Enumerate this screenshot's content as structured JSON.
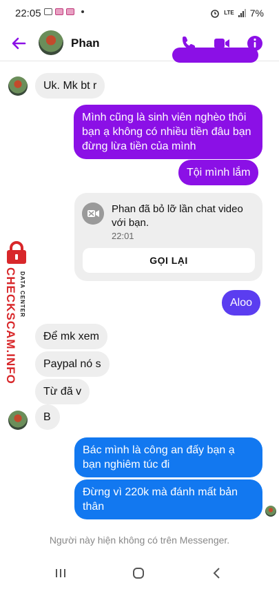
{
  "status_bar": {
    "time": "22:05",
    "network": "LTE",
    "battery": "7%"
  },
  "header": {
    "contact_name": "Phan"
  },
  "messages": [
    {
      "id": "m1",
      "side": "incoming",
      "text": "Uk. Mk bt r"
    },
    {
      "id": "m2",
      "side": "outgoing",
      "text": "Mình cũng là sinh viên nghèo thôi bạn ạ không có nhiều tiền đâu bạn đừng lừa tiền của mình"
    },
    {
      "id": "m3",
      "side": "outgoing",
      "text": "Tội mình lắm"
    },
    {
      "id": "m4",
      "side": "outgoing",
      "text": "Aloo"
    },
    {
      "id": "m5",
      "side": "incoming",
      "text": "Để mk xem"
    },
    {
      "id": "m6",
      "side": "incoming",
      "text": "Paypal nó s"
    },
    {
      "id": "m7",
      "side": "incoming",
      "text": "Từ đã v"
    },
    {
      "id": "m8",
      "side": "incoming",
      "text": "B"
    },
    {
      "id": "m9",
      "side": "outgoing",
      "text": "Bác mình là công an đấy bạn ạ bạn nghiêm túc đi"
    },
    {
      "id": "m10",
      "side": "outgoing",
      "text": "Đừng vì 220k mà đánh mất bản thân"
    }
  ],
  "missed_call": {
    "text": "Phan đã bỏ lỡ lần chat video với bạn.",
    "time": "22:01",
    "button_label": "GỌI LẠI"
  },
  "watermark": {
    "brand": "CHECKSCAM.INFO",
    "sub": "DATA CENTER"
  },
  "footer_note": "Người này hiện không có trên Messenger.",
  "colors": {
    "accent": "#8b10e6",
    "violet": "#5b3df0",
    "blue": "#1278f0",
    "incoming_bg": "#eeeeee",
    "brand_red": "#d8272a"
  },
  "icons": [
    "back-arrow-icon",
    "phone-icon",
    "video-camera-icon",
    "info-icon",
    "missed-video-call-icon",
    "lock-icon",
    "recents-icon",
    "home-icon",
    "back-nav-icon"
  ]
}
